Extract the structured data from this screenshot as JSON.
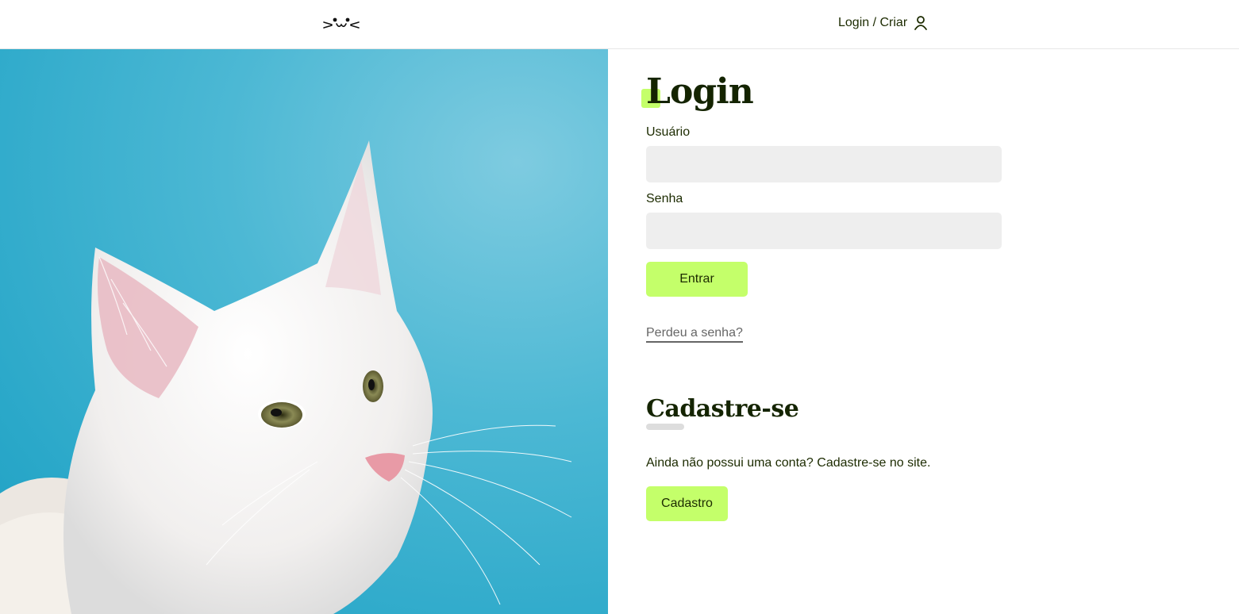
{
  "header": {
    "logo_icon": "cat-face-icon",
    "login_link": "Login / Criar",
    "user_icon": "user-icon"
  },
  "photo": {
    "subject": "white-cat-photo"
  },
  "login": {
    "title": "Login",
    "username_label": "Usuário",
    "username_value": "",
    "password_label": "Senha",
    "password_value": "",
    "submit": "Entrar",
    "lost_password": "Perdeu a senha?"
  },
  "signup": {
    "title": "Cadastre-se",
    "text": "Ainda não possui uma conta? Cadastre-se no site.",
    "button": "Cadastro"
  },
  "colors": {
    "accent": "#c4ff6a",
    "text": "#1c2b00",
    "input_bg": "#eeeeee"
  }
}
